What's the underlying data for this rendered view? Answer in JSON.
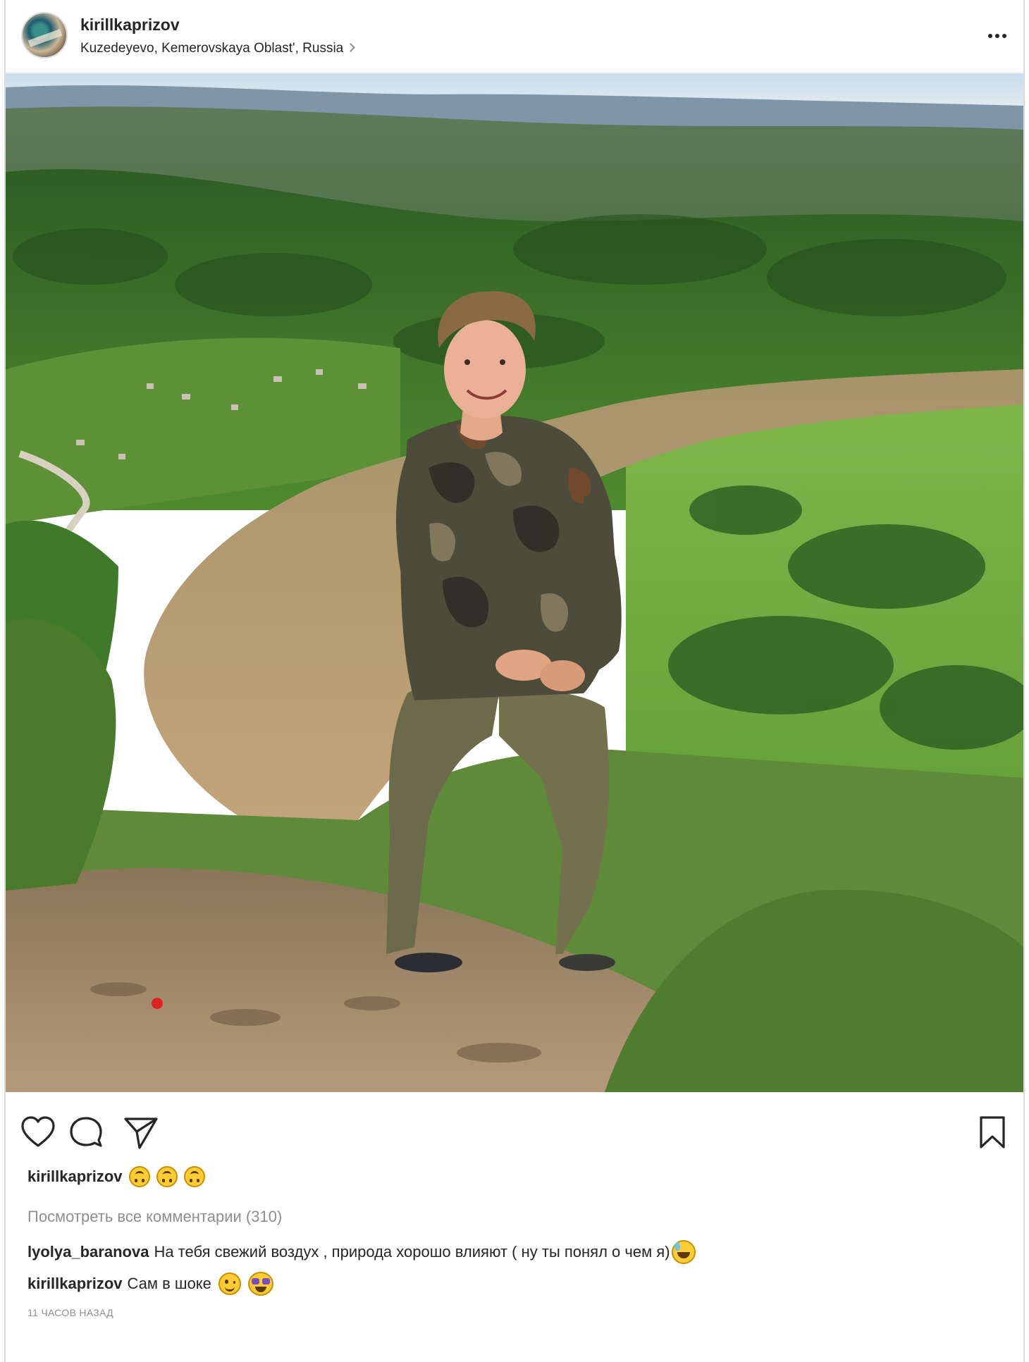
{
  "post": {
    "username": "kirillkaprizov",
    "location": "Kuzedeyevo, Kemerovskaya Oblast', Russia",
    "more_icon": "more-horizontal-icon"
  },
  "photo": {
    "icon": "photo-landscape"
  },
  "actions": {
    "like_icon": "heart-icon",
    "comment_icon": "comment-icon",
    "share_icon": "send-icon",
    "save_icon": "bookmark-icon"
  },
  "caption": {
    "username": "kirillkaprizov",
    "emojis": [
      "upside-down-face",
      "upside-down-face",
      "upside-down-face"
    ]
  },
  "view_all_comments": "Посмотреть все комментарии (310)",
  "comments": [
    {
      "username": "lyolya_baranova",
      "text": "На тебя свежий воздух , природа хорошо влияют ( ну ты понял о чем я)",
      "emoji": "grinning-sweat"
    },
    {
      "username": "kirillkaprizov",
      "text": "Сам в шоке",
      "emojis": [
        "winking-face",
        "star-struck"
      ]
    }
  ],
  "timestamp": "11 ЧАСОВ НАЗАД",
  "colors": {
    "text": "#262626",
    "muted": "#8e8e8e",
    "border": "#dbdbdb"
  }
}
